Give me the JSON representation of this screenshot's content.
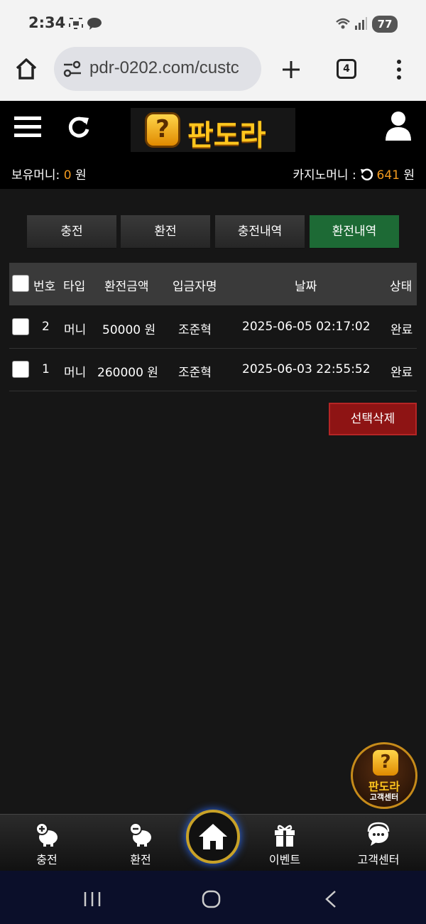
{
  "status_bar": {
    "time": "2:34",
    "battery": "77"
  },
  "browser": {
    "url": "pdr-0202.com/custc",
    "tab_count": "4"
  },
  "site": {
    "logo_text": "판도라",
    "logo_mark": "?"
  },
  "money": {
    "holding_label": "보유머니:",
    "holding_value": "0",
    "holding_unit": "원",
    "casino_label": "카지노머니 :",
    "casino_value": "641",
    "casino_unit": "원"
  },
  "tabs": [
    {
      "label": "충전",
      "active": false
    },
    {
      "label": "환전",
      "active": false
    },
    {
      "label": "충전내역",
      "active": false
    },
    {
      "label": "환전내역",
      "active": true
    }
  ],
  "table": {
    "headers": [
      "번호",
      "타입",
      "환전금액",
      "입금자명",
      "날짜",
      "상태"
    ],
    "rows": [
      {
        "no": "2",
        "type": "머니",
        "amount": "50000 원",
        "name": "조준혁",
        "date": "2025-06-05 02:17:02",
        "status": "완료"
      },
      {
        "no": "1",
        "type": "머니",
        "amount": "260000 원",
        "name": "조준혁",
        "date": "2025-06-03 22:55:52",
        "status": "완료"
      }
    ]
  },
  "delete_button": "선택삭제",
  "support_float": {
    "line1": "판도라",
    "line2": "고객센터"
  },
  "bottom_nav": [
    {
      "label": "충전",
      "icon": "piggy-plus-icon"
    },
    {
      "label": "환전",
      "icon": "piggy-minus-icon"
    },
    {
      "label": "",
      "icon": "home-icon"
    },
    {
      "label": "이벤트",
      "icon": "gift-icon"
    },
    {
      "label": "고객센터",
      "icon": "chat-support-icon"
    }
  ],
  "colors": {
    "accent_orange": "#f39a1e",
    "active_tab": "#1d6a35",
    "delete_red": "#8e1414"
  }
}
